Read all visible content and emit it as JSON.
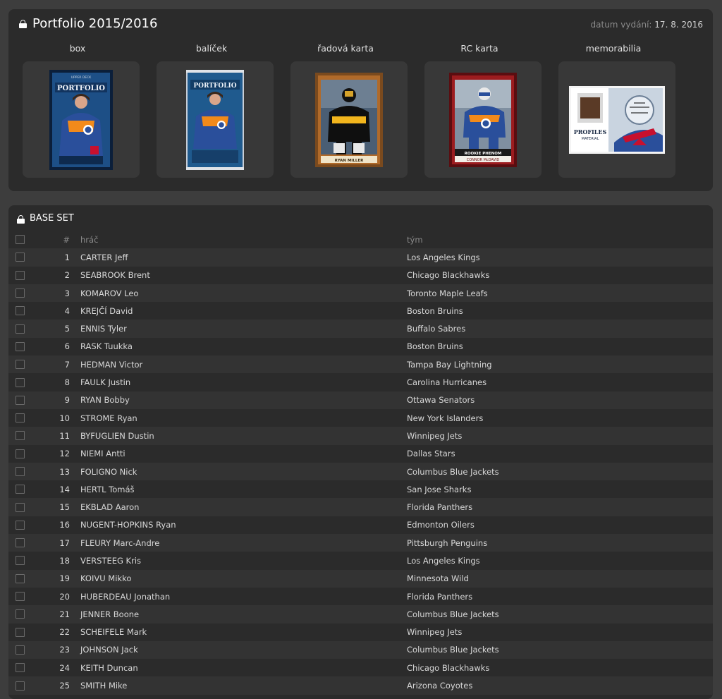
{
  "set": {
    "title": "Portfolio 2015/2016",
    "release_label": "datum vydání:",
    "release_date": "17. 8. 2016"
  },
  "categories": [
    {
      "label": "box"
    },
    {
      "label": "balíček"
    },
    {
      "label": "řadová karta"
    },
    {
      "label": "RC karta"
    },
    {
      "label": "memorabilia"
    }
  ],
  "card_texts": {
    "box_brand": "PORTFOLIO",
    "box_top": "UPPER DECK",
    "pack_brand": "PORTFOLIO",
    "base_card_name": "RYAN MILLER",
    "rc_card_banner": "ROOKIE PHENOM",
    "rc_card_name": "CONNOR McDAVID",
    "memo_brand": "PROFILES",
    "memo_sub": "MATERIAL"
  },
  "base": {
    "title": "BASE SET",
    "columns": {
      "num": "#",
      "player": "hráč",
      "team": "tým"
    },
    "rows": [
      {
        "num": "1",
        "player": "CARTER Jeff",
        "team": "Los Angeles Kings"
      },
      {
        "num": "2",
        "player": "SEABROOK Brent",
        "team": "Chicago Blackhawks"
      },
      {
        "num": "3",
        "player": "KOMAROV Leo",
        "team": "Toronto Maple Leafs"
      },
      {
        "num": "4",
        "player": "KREJČÍ David",
        "team": "Boston Bruins"
      },
      {
        "num": "5",
        "player": "ENNIS Tyler",
        "team": "Buffalo Sabres"
      },
      {
        "num": "6",
        "player": "RASK Tuukka",
        "team": "Boston Bruins"
      },
      {
        "num": "7",
        "player": "HEDMAN Victor",
        "team": "Tampa Bay Lightning"
      },
      {
        "num": "8",
        "player": "FAULK Justin",
        "team": "Carolina Hurricanes"
      },
      {
        "num": "9",
        "player": "RYAN Bobby",
        "team": "Ottawa Senators"
      },
      {
        "num": "10",
        "player": "STROME Ryan",
        "team": "New York Islanders"
      },
      {
        "num": "11",
        "player": "BYFUGLIEN Dustin",
        "team": "Winnipeg Jets"
      },
      {
        "num": "12",
        "player": "NIEMI Antti",
        "team": "Dallas Stars"
      },
      {
        "num": "13",
        "player": "FOLIGNO Nick",
        "team": "Columbus Blue Jackets"
      },
      {
        "num": "14",
        "player": "HERTL Tomáš",
        "team": "San Jose Sharks"
      },
      {
        "num": "15",
        "player": "EKBLAD Aaron",
        "team": "Florida Panthers"
      },
      {
        "num": "16",
        "player": "NUGENT-HOPKINS Ryan",
        "team": "Edmonton Oilers"
      },
      {
        "num": "17",
        "player": "FLEURY Marc-Andre",
        "team": "Pittsburgh Penguins"
      },
      {
        "num": "18",
        "player": "VERSTEEG Kris",
        "team": "Los Angeles Kings"
      },
      {
        "num": "19",
        "player": "KOIVU Mikko",
        "team": "Minnesota Wild"
      },
      {
        "num": "20",
        "player": "HUBERDEAU Jonathan",
        "team": "Florida Panthers"
      },
      {
        "num": "21",
        "player": "JENNER Boone",
        "team": "Columbus Blue Jackets"
      },
      {
        "num": "22",
        "player": "SCHEIFELE Mark",
        "team": "Winnipeg Jets"
      },
      {
        "num": "23",
        "player": "JOHNSON Jack",
        "team": "Columbus Blue Jackets"
      },
      {
        "num": "24",
        "player": "KEITH Duncan",
        "team": "Chicago Blackhawks"
      },
      {
        "num": "25",
        "player": "SMITH Mike",
        "team": "Arizona Coyotes"
      }
    ]
  }
}
